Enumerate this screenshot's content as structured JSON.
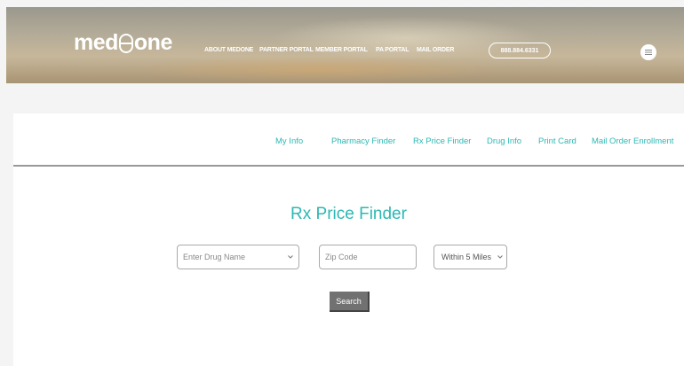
{
  "header": {
    "logo": {
      "left": "med",
      "right": "one"
    },
    "nav": [
      "ABOUT MEDONE",
      "PARTNER PORTAL",
      "MEMBER PORTAL",
      "PA PORTAL",
      "MAIL ORDER"
    ],
    "phone": "888.884.6331"
  },
  "subnav": [
    "My Info",
    "Pharmacy Finder",
    "Rx Price Finder",
    "Drug Info",
    "Print Card",
    "Mail Order Enrollment"
  ],
  "page": {
    "title": "Rx Price Finder",
    "drug_placeholder": "Enter Drug Name",
    "zip_placeholder": "Zip Code",
    "radius_selected": "Within 5 Miles",
    "search_label": "Search"
  },
  "colors": {
    "accent": "#2cb8b4",
    "button": "#717171"
  },
  "icons": {
    "menu": "menu-icon",
    "select": "chevron-down-icon"
  }
}
